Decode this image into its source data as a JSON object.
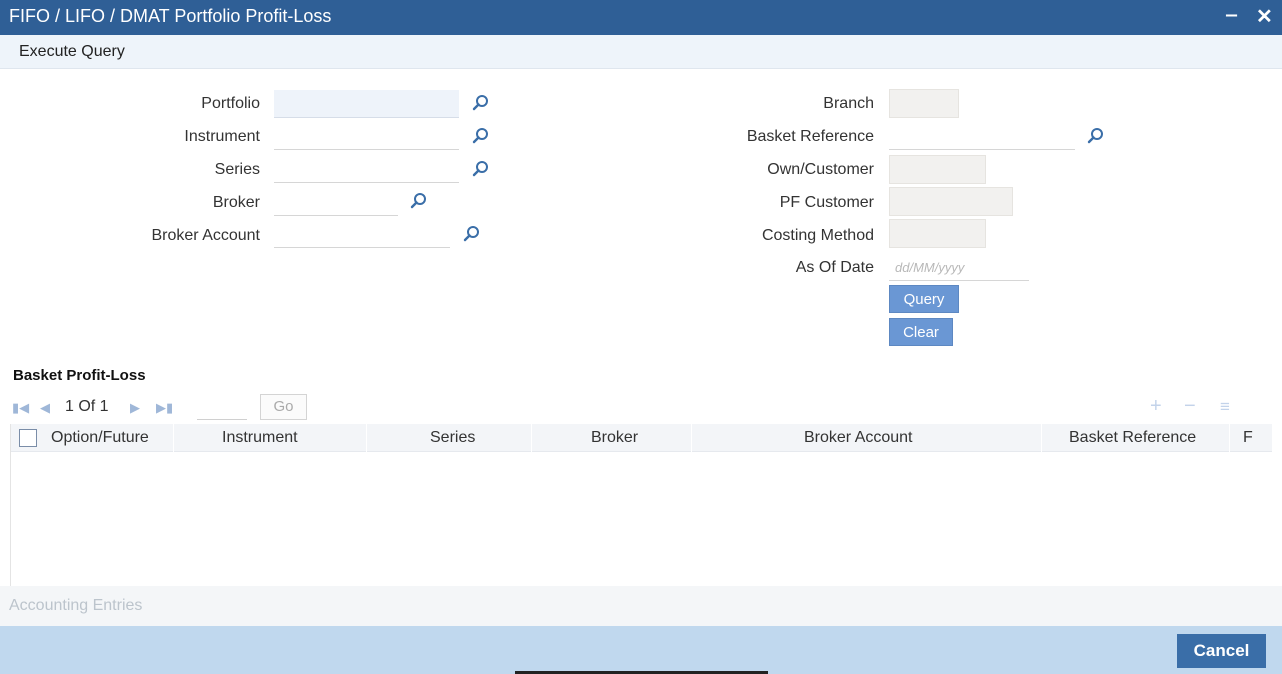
{
  "window": {
    "title": "FIFO / LIFO / DMAT Portfolio Profit-Loss",
    "minimize_label": "‒",
    "close_label": "✕"
  },
  "toolbar": {
    "execute_query": "Execute Query"
  },
  "form": {
    "portfolio": {
      "label": "Portfolio",
      "value": ""
    },
    "instrument": {
      "label": "Instrument",
      "value": ""
    },
    "series": {
      "label": "Series",
      "value": ""
    },
    "broker": {
      "label": "Broker",
      "value": ""
    },
    "broker_account": {
      "label": "Broker Account",
      "value": ""
    },
    "branch": {
      "label": "Branch",
      "value": ""
    },
    "basket_reference": {
      "label": "Basket Reference",
      "value": ""
    },
    "own_customer": {
      "label": "Own/Customer",
      "value": ""
    },
    "pf_customer": {
      "label": "PF Customer",
      "value": ""
    },
    "costing_method": {
      "label": "Costing Method",
      "value": ""
    },
    "as_of_date": {
      "label": "As Of Date",
      "placeholder": "dd/MM/yyyy",
      "value": ""
    },
    "query_button": "Query",
    "clear_button": "Clear"
  },
  "basket": {
    "title": "Basket Profit-Loss",
    "pager": {
      "text": "1 Of 1",
      "go_label": "Go",
      "page_value": ""
    },
    "columns": [
      "Option/Future",
      "Instrument",
      "Series",
      "Broker",
      "Broker Account",
      "Basket Reference",
      "F"
    ],
    "rows": []
  },
  "accounting_entries": "Accounting Entries",
  "footer": {
    "cancel": "Cancel"
  },
  "colors": {
    "titlebar": "#2f5f96",
    "button": "#6a97d4",
    "footer": "#c0d8ee",
    "cancel": "#3a6ea8"
  }
}
